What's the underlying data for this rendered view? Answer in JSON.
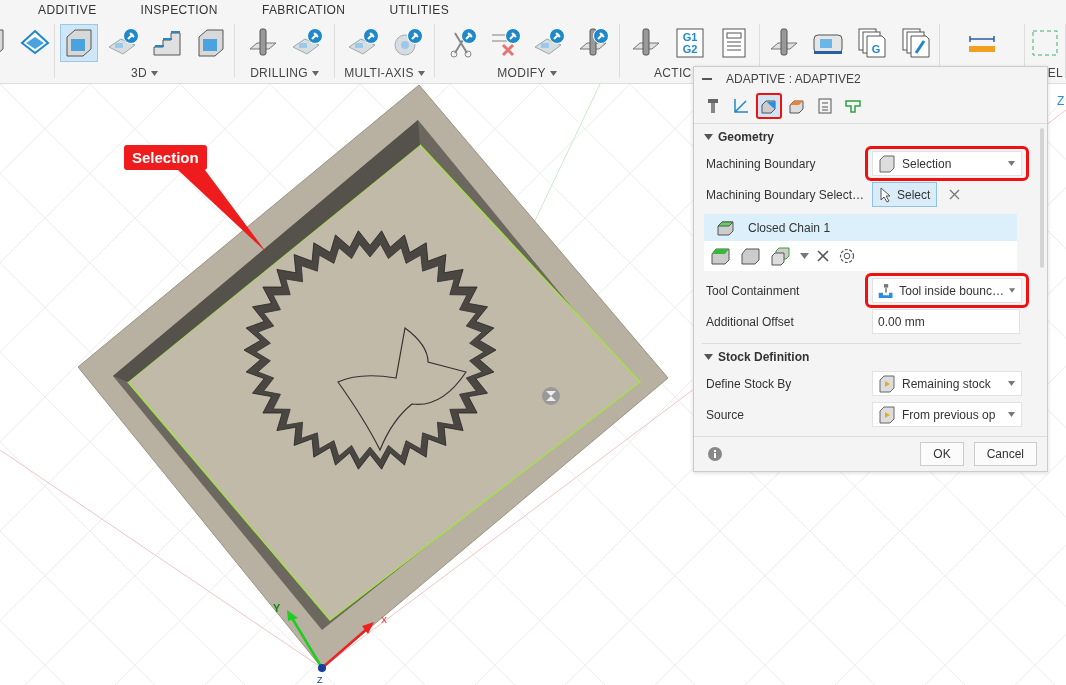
{
  "toolbar": {
    "tabs": [
      "ADDITIVE",
      "INSPECTION",
      "FABRICATION",
      "UTILITIES"
    ],
    "groups": [
      {
        "tools": [
          {
            "selected": false
          },
          {
            "selected": false
          }
        ]
      },
      {
        "label": "3D",
        "dropdown": true,
        "tools": [
          {
            "selected": true
          },
          {
            "selected": false
          },
          {
            "selected": false
          },
          {
            "selected": false
          }
        ]
      },
      {
        "label": "DRILLING",
        "dropdown": true,
        "tools": [
          {
            "selected": false
          },
          {
            "selected": false
          }
        ]
      },
      {
        "label": "MULTI-AXIS",
        "dropdown": true,
        "tools": [
          {
            "selected": false
          },
          {
            "selected": false
          }
        ]
      },
      {
        "label": "MODIFY",
        "dropdown": true,
        "tools": [
          {
            "selected": false
          },
          {
            "selected": false
          },
          {
            "selected": false
          },
          {
            "selected": false
          }
        ]
      },
      {
        "label": "ACTIC",
        "dropdown": false,
        "tools": [
          {
            "selected": false
          },
          {
            "selected": false,
            "glyph": [
              "G1",
              "G2"
            ]
          },
          {
            "selected": false
          }
        ]
      },
      {
        "tools": [
          {
            "selected": false
          },
          {
            "selected": false
          },
          {
            "selected": false,
            "glyph": [
              "G"
            ]
          },
          {
            "selected": false
          }
        ]
      },
      {
        "tools": [
          {
            "selected": false
          }
        ]
      },
      {
        "label": "EL",
        "dropdown": false,
        "tools": [
          {
            "selected": false
          }
        ]
      }
    ]
  },
  "viewport": {
    "callout": "Selection",
    "viewcube": "Z",
    "axes": [
      "X",
      "Y",
      "Z"
    ]
  },
  "panel": {
    "title": "ADAPTIVE : ADAPTIVE2",
    "tabs": [
      {
        "selected": false,
        "highlighted": false
      },
      {
        "selected": false,
        "highlighted": false
      },
      {
        "selected": true,
        "highlighted": true
      },
      {
        "selected": false,
        "highlighted": false
      },
      {
        "selected": false,
        "highlighted": false
      },
      {
        "selected": false,
        "highlighted": false
      }
    ],
    "sections": [
      {
        "title": "Geometry",
        "expanded": true,
        "rows": [
          {
            "kind": "dropdown",
            "label": "Machining Boundary",
            "value": "Selection",
            "highlighted": true
          },
          {
            "kind": "select",
            "label": "Machining Boundary Select…",
            "button": "Select"
          },
          {
            "kind": "chain-list",
            "items": [
              {
                "label": "Closed Chain 1",
                "selected": true
              }
            ]
          },
          {
            "kind": "dropdown",
            "label": "Tool Containment",
            "value": "Tool inside bounc…",
            "highlighted": true
          },
          {
            "kind": "number",
            "label": "Additional Offset",
            "value": "0.00 mm"
          }
        ]
      },
      {
        "title": "Stock Definition",
        "expanded": true,
        "rows": [
          {
            "kind": "dropdown",
            "label": "Define Stock By",
            "value": "Remaining stock",
            "highlighted": false
          },
          {
            "kind": "dropdown",
            "label": "Source",
            "value": "From previous op",
            "highlighted": false
          }
        ]
      }
    ],
    "buttons": [
      "OK",
      "Cancel"
    ]
  }
}
